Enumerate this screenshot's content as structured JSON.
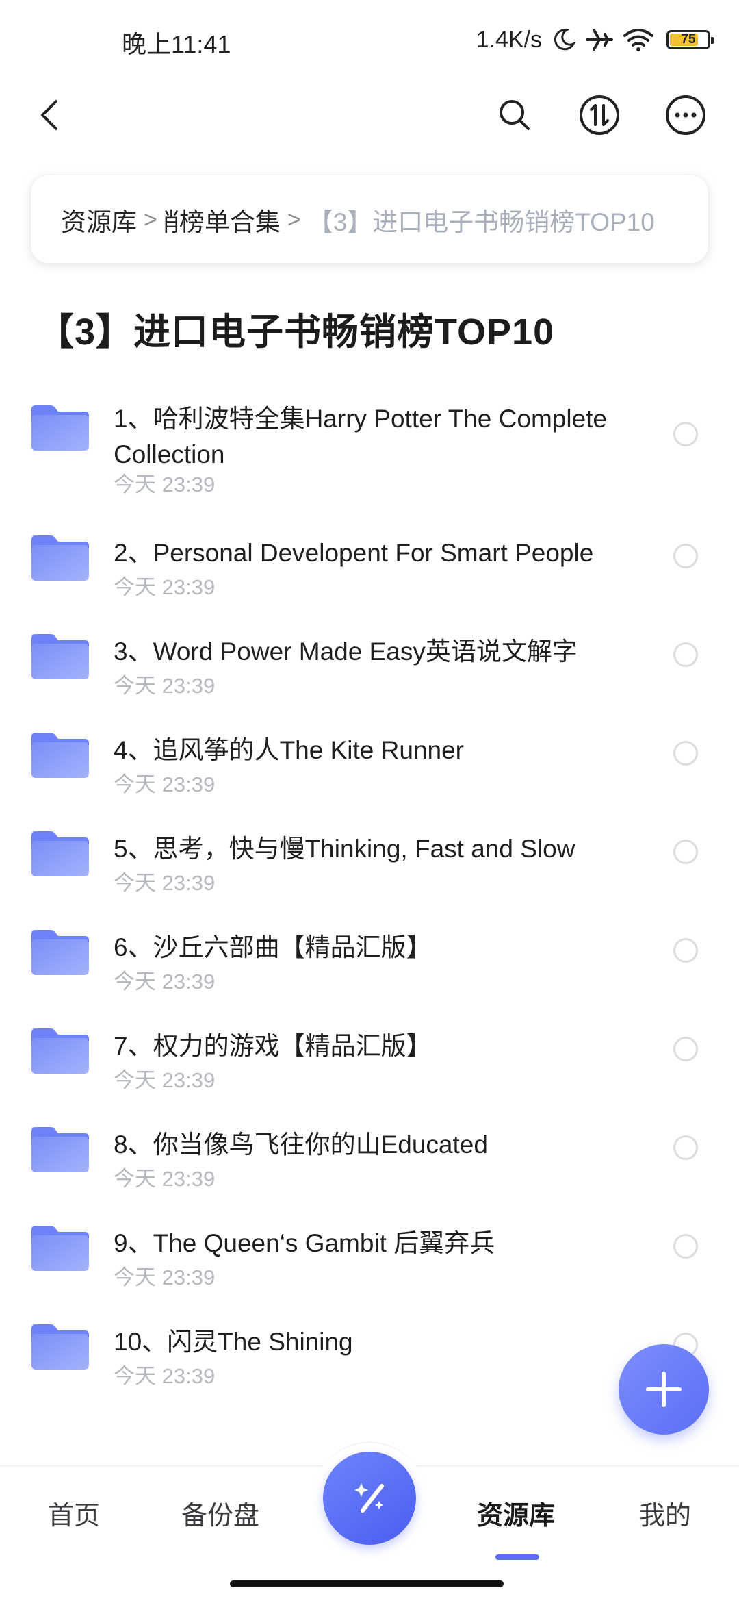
{
  "status_bar": {
    "time": "晚上11:41",
    "net_speed": "1.4K/s",
    "battery": "75",
    "battery_level": 0.75,
    "icons": [
      "moon-icon",
      "airplane-icon",
      "wifi-icon",
      "battery-icon"
    ]
  },
  "top_bar": {
    "icons": [
      "back-arrow-icon",
      "search-icon",
      "transfer-icon",
      "more-icon"
    ]
  },
  "breadcrumb": {
    "root": "资源库",
    "middle": "畅销榜单合集",
    "current": "【3】进口电子书畅销榜TOP10",
    "separator": ">"
  },
  "page_title": "【3】进口电子书畅销榜TOP10",
  "files": [
    {
      "name": "1、哈利波特全集Harry Potter The Complete Collection",
      "time": "今天 23:39"
    },
    {
      "name": "2、Personal Developent For Smart People",
      "time": "今天 23:39"
    },
    {
      "name": "3、Word Power Made Easy英语说文解字",
      "time": "今天 23:39"
    },
    {
      "name": "4、追风筝的人The Kite Runner",
      "time": "今天 23:39"
    },
    {
      "name": "5、思考，快与慢Thinking, Fast and Slow",
      "time": "今天 23:39"
    },
    {
      "name": "6、沙丘六部曲【精品汇版】",
      "time": "今天 23:39"
    },
    {
      "name": "7、权力的游戏【精品汇版】",
      "time": "今天 23:39"
    },
    {
      "name": "8、你当像鸟飞往你的山Educated",
      "time": "今天 23:39"
    },
    {
      "name": "9、The Queen‘s Gambit 后翼弃兵",
      "time": "今天 23:39"
    },
    {
      "name": "10、闪灵The Shining",
      "time": "今天 23:39"
    }
  ],
  "bottom_nav": {
    "tabs": [
      "首页",
      "备份盘",
      "资源库",
      "我的"
    ],
    "active": "资源库"
  },
  "colors": {
    "accent": "#5a6ef5",
    "folder": "#8094f8",
    "muted_text": "#b6b9c0"
  }
}
